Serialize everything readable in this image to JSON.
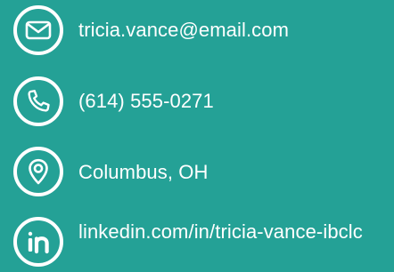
{
  "contact": {
    "email": {
      "icon": "envelope-icon",
      "text": "tricia.vance@email.com"
    },
    "phone": {
      "icon": "phone-icon",
      "text": "(614) 555-0271"
    },
    "location": {
      "icon": "map-pin-icon",
      "text": "Columbus, OH"
    },
    "linkedin": {
      "icon": "linkedin-icon",
      "text": "linkedin.com/in/tricia-vance-ibclc"
    }
  },
  "colors": {
    "background": "#24a196",
    "foreground": "#ffffff"
  }
}
